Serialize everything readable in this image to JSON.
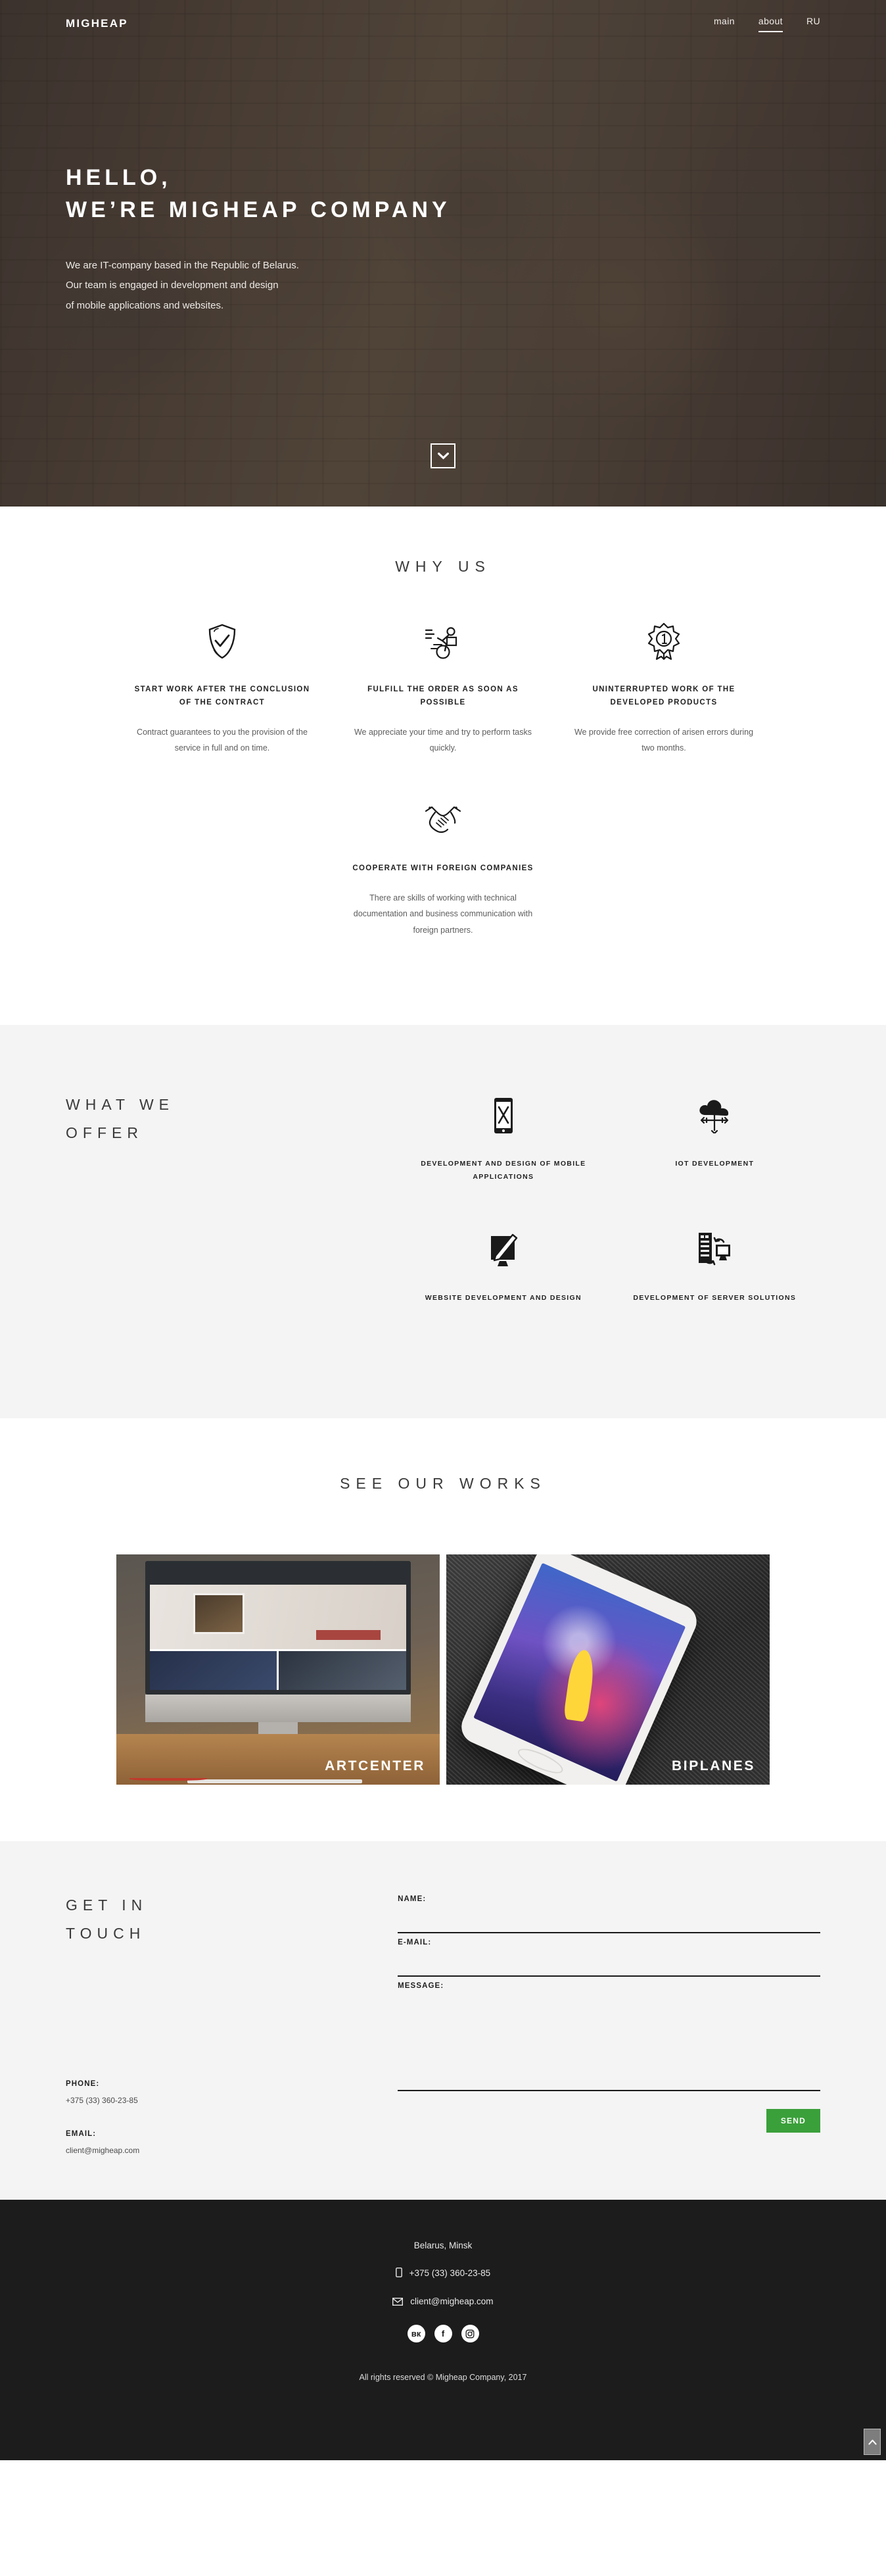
{
  "header": {
    "brand": "MIGHEAP",
    "nav": [
      {
        "label": "main",
        "active": false
      },
      {
        "label": "about",
        "active": true
      },
      {
        "label": "RU",
        "active": false
      }
    ]
  },
  "hero": {
    "title_line1": "HELLO,",
    "title_line2": "WE’RE MIGHEAP COMPANY",
    "sub_line1": "We are IT-company based in the Republic of Belarus.",
    "sub_line2": "Our team is engaged in development and design",
    "sub_line3": "of mobile applications and websites.",
    "scroll_icon": "chevron-down-icon"
  },
  "why_us": {
    "title": "WHY US",
    "cards": [
      {
        "icon": "shield-check-icon",
        "heading": "START WORK AFTER THE CONCLUSION OF THE CONTRACT",
        "text": "Contract guarantees to you the provision of the service in full and on time."
      },
      {
        "icon": "cyclist-delivery-icon",
        "heading": "FULFILL THE ORDER AS SOON AS POSSIBLE",
        "text": "We appreciate your time and try to perform tasks quickly."
      },
      {
        "icon": "award-ribbon-icon",
        "heading": "UNINTERRUPTED WORK OF THE DEVELOPED PRODUCTS",
        "text": "We provide free correction of arisen errors during two months."
      },
      {
        "icon": "handshake-icon",
        "heading": "COOPERATE WITH FOREIGN COMPANIES",
        "text": "There are skills of working with technical documentation and business communication with foreign partners."
      }
    ]
  },
  "offer": {
    "title_line1": "WHAT WE",
    "title_line2": "OFFER",
    "items": [
      {
        "icon": "smartphone-icon",
        "label": "DEVELOPMENT AND DESIGN OF MOBILE APPLICATIONS"
      },
      {
        "icon": "cloud-iot-icon",
        "label": "IOT DEVELOPMENT"
      },
      {
        "icon": "monitor-pen-icon",
        "label": "WEBSITE DEVELOPMENT AND DESIGN"
      },
      {
        "icon": "server-sync-icon",
        "label": "DEVELOPMENT OF SERVER SOLUTIONS"
      }
    ]
  },
  "works": {
    "title": "SEE OUR WORKS",
    "items": [
      {
        "label": "ARTCENTER"
      },
      {
        "label": "BIPLANES"
      }
    ]
  },
  "contact": {
    "title_line1": "GET IN",
    "title_line2": "TOUCH",
    "fields": {
      "name_label": "NAME:",
      "name_value": "",
      "email_label": "E-MAIL:",
      "email_value": "",
      "message_label": "MESSAGE:",
      "message_value": ""
    },
    "send_label": "SEND",
    "send_color": "#3aa03a",
    "phone_label": "PHONE:",
    "phone_value": "+375 (33) 360-23-85",
    "email_label": "EMAIL:",
    "email_value": "client@migheap.com"
  },
  "footer": {
    "location": "Belarus, Minsk",
    "phone": "+375 (33) 360-23-85",
    "email": "client@migheap.com",
    "phone_icon": "mobile-phone-icon",
    "email_icon": "envelope-icon",
    "socials": [
      {
        "name": "vk-icon",
        "glyph": "вк"
      },
      {
        "name": "facebook-icon",
        "glyph": "f"
      },
      {
        "name": "instagram-icon",
        "glyph": "▣"
      }
    ],
    "copyright": "All rights reserved © Migheap Company, 2017",
    "to_top_icon": "chevron-up-icon",
    "background": "#1c1c1c"
  }
}
